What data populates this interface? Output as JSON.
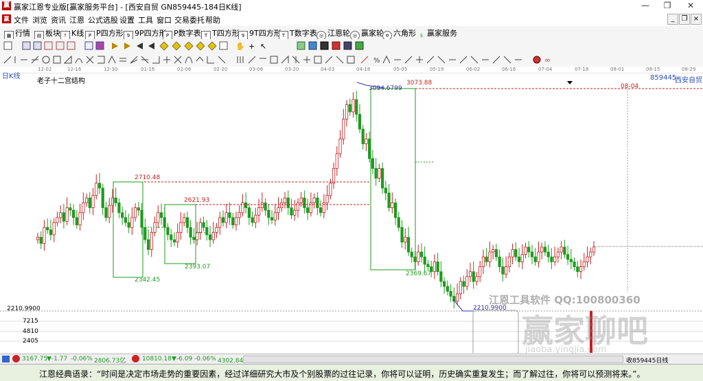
{
  "window": {
    "title": "赢家江恩专业版[赢家服务平台] - [西安自贸 GN859445-184日K线]",
    "logo_text": "赢"
  },
  "menu": [
    "文件",
    "浏览",
    "资讯",
    "江恩",
    "公式选股",
    "设置",
    "工具",
    "窗口",
    "交易委托",
    "帮助"
  ],
  "toolbar1": [
    "行情",
    "板块",
    "K线",
    "P四方形",
    "9P四方形",
    "P数字表",
    "T四方形",
    "9T四方形",
    "T数字表",
    "江恩轮",
    "赢家轮",
    "六角形",
    "赢家服务"
  ],
  "date_axis": [
    "12-02",
    "12-16",
    "12-30",
    "01-16",
    "02-06",
    "02-20",
    "03-06",
    "03-20",
    "04-03",
    "04-18",
    "05-05",
    "05-19",
    "06-02",
    "06-16",
    "07-04",
    "07-18",
    "08-01",
    "08-15",
    "08-29"
  ],
  "chart_header": {
    "period": "日K线",
    "structure": "老子十二宫结构",
    "code": "859445",
    "name": "西安自贸",
    "date_marker": "08-04"
  },
  "annotations": {
    "high_peak": "3094.6799",
    "high_line": "3073.88",
    "level_a": "2710.48",
    "level_b": "2621.93",
    "low_a": "2342.45",
    "low_b": "2393.07",
    "low_c": "2369.67",
    "low_d": "2210.9900",
    "left_low": "2210.9900"
  },
  "volume_axis": [
    "7215",
    "4810",
    "2405"
  ],
  "watermark": {
    "line1": "江恩工具软件  QQ:100800360",
    "brand": "赢家聊吧",
    "url": "jiaoba.yingjia.com"
  },
  "status": {
    "sh_index": "3167.75",
    "sh_change": "▼-1.77",
    "sh_pct": "-0.06%",
    "sh_amount": "2806.73亿",
    "sz_index": "10810.18",
    "sz_change": "▼-6.09",
    "sz_pct": "-0.06%",
    "sz_amount": "4302.84亿",
    "right": "收859445日线"
  },
  "quote": "江恩经典语录：“时间是决定市场走势的重要因素，经过详细研究大市及个别股票的过往记录，你将可以证明，历史确实重复发生；而了解过往，你将可以预测将来。”。",
  "colors": {
    "up": "#c81e1e",
    "down": "#1e9b1e",
    "dashed": "#c81e1e",
    "box": "#1e9b1e",
    "trend": "#3333aa"
  },
  "chart_data": {
    "type": "candlestick",
    "title": "老子十二宫结构",
    "ylim": [
      2180,
      3110
    ],
    "levels": [
      3073.88,
      2710.48,
      2621.93,
      2210.99
    ],
    "key_points": [
      {
        "label": "3094.6799",
        "y": 3094.68
      },
      {
        "label": "2342.45",
        "y": 2342.45
      },
      {
        "label": "2393.07",
        "y": 2393.07
      },
      {
        "label": "2369.67",
        "y": 2369.67
      },
      {
        "label": "2210.9900",
        "y": 2210.99
      }
    ],
    "closes": [
      2480,
      2455,
      2520,
      2510,
      2490,
      2540,
      2560,
      2580,
      2545,
      2600,
      2590,
      2560,
      2530,
      2580,
      2620,
      2640,
      2600,
      2650,
      2700,
      2680,
      2600,
      2560,
      2610,
      2640,
      2620,
      2580,
      2560,
      2540,
      2520,
      2560,
      2600,
      2590,
      2520,
      2470,
      2430,
      2500,
      2540,
      2580,
      2560,
      2520,
      2490,
      2470,
      2460,
      2500,
      2540,
      2560,
      2520,
      2480,
      2470,
      2500,
      2540,
      2520,
      2490,
      2470,
      2500,
      2520,
      2560,
      2540,
      2580,
      2560,
      2530,
      2560,
      2580,
      2620,
      2600,
      2560,
      2540,
      2570,
      2600,
      2620,
      2590,
      2560,
      2550,
      2580,
      2600,
      2620,
      2640,
      2600,
      2570,
      2590,
      2620,
      2640,
      2600,
      2580,
      2620,
      2640,
      2600,
      2580,
      2620,
      2650,
      2700,
      2760,
      2820,
      2880,
      2960,
      3020,
      2990,
      3040,
      2980,
      2920,
      2860,
      2880,
      2800,
      2760,
      2720,
      2760,
      2680,
      2660,
      2600,
      2620,
      2560,
      2520,
      2460,
      2480,
      2420,
      2400,
      2380,
      2420,
      2400,
      2370,
      2360,
      2340,
      2380,
      2340,
      2300,
      2280,
      2260,
      2240,
      2220,
      2250,
      2300,
      2280,
      2320,
      2340,
      2300,
      2320,
      2360,
      2400,
      2380,
      2420,
      2430,
      2400,
      2360,
      2330,
      2360,
      2400,
      2430,
      2400,
      2380,
      2410,
      2440,
      2420,
      2400,
      2380,
      2420,
      2440,
      2420,
      2400,
      2380,
      2400,
      2420,
      2440,
      2410,
      2390,
      2380,
      2360,
      2340,
      2360,
      2380,
      2400,
      2420,
      2440
    ]
  }
}
